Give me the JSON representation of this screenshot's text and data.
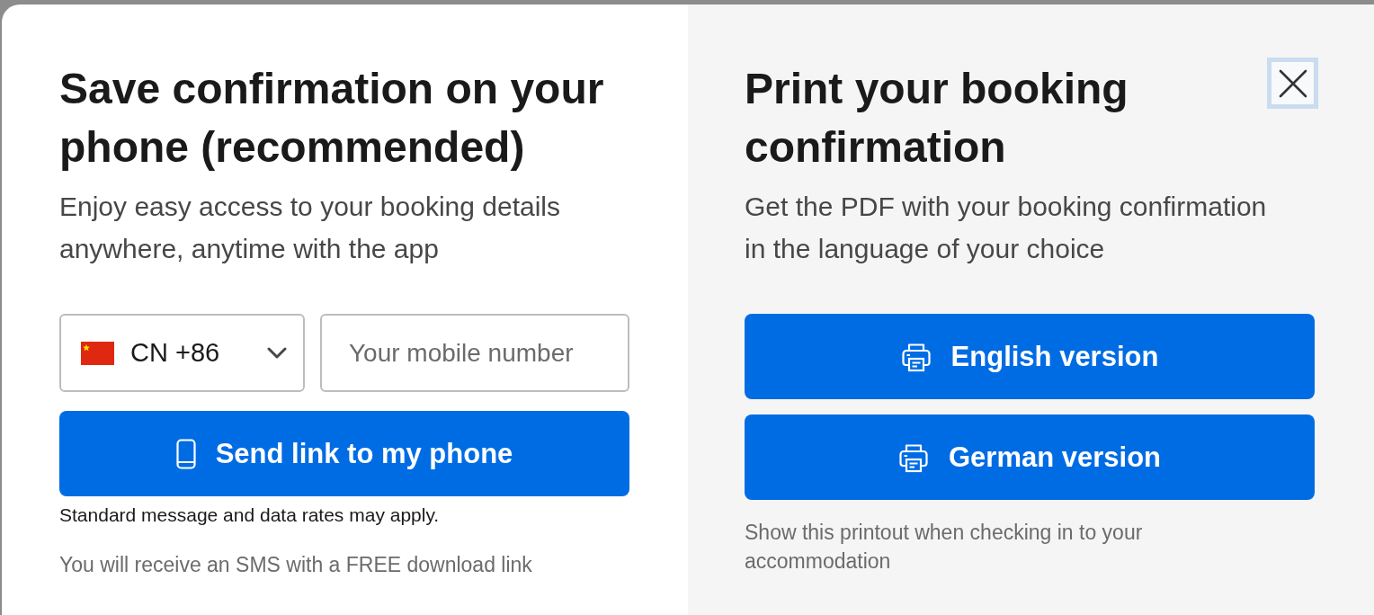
{
  "left_panel": {
    "title": "Save confirmation on your phone (recommended)",
    "subtitle": "Enjoy easy access to your booking details anywhere, anytime with the app",
    "country_select": {
      "value": "CN +86"
    },
    "phone_field": {
      "placeholder": "Your mobile number"
    },
    "send_button": {
      "label": "Send link to my phone"
    },
    "disclaimer": "Standard message and data rates may apply.",
    "note": "You will receive an SMS with a FREE download link"
  },
  "right_panel": {
    "title": "Print your booking confirmation",
    "close_button": {
      "focused": true
    },
    "subtitle": "Get the PDF with your booking confirmation in the language of your choice",
    "buttons": [
      {
        "label": "English version"
      },
      {
        "label": "German version"
      }
    ],
    "note": "Show this printout when checking in to your accommodation"
  }
}
